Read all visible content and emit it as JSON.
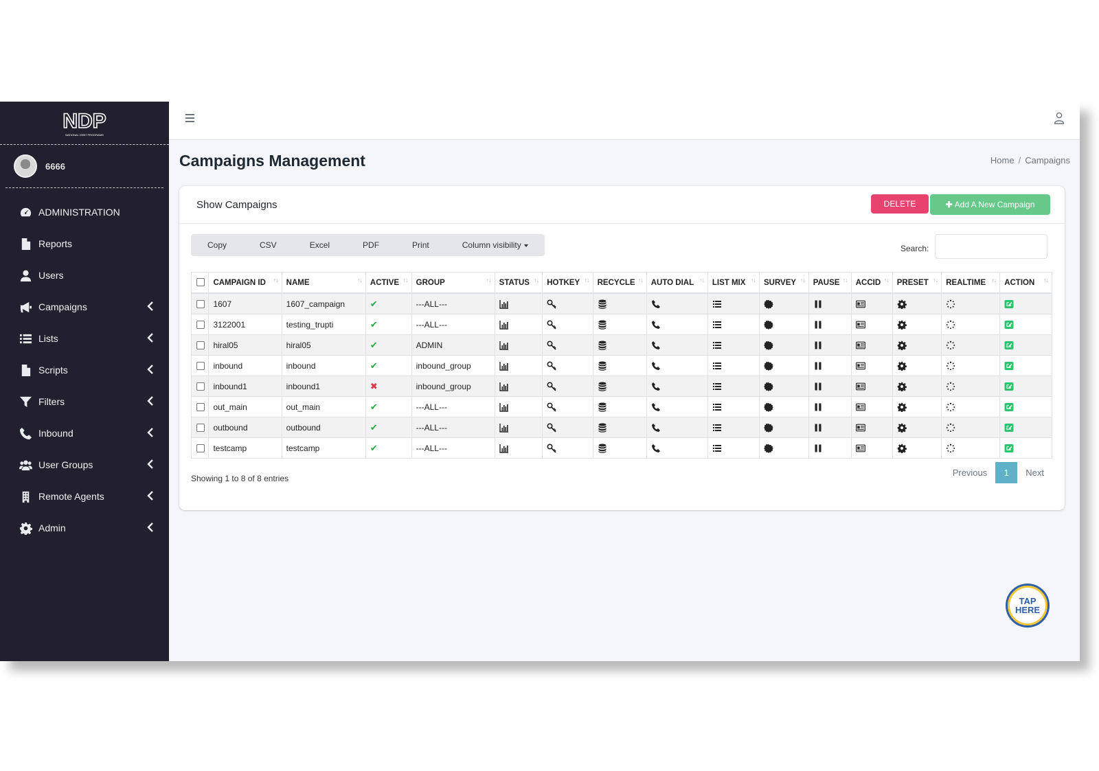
{
  "brand": {
    "logo_text": "NDP",
    "logo_subtext": "NATIONAL DEBT PROGRAMS"
  },
  "user": {
    "name": "6666"
  },
  "sidebar": {
    "items": [
      {
        "label": "ADMINISTRATION",
        "icon": "dashboard-icon",
        "has_chevron": false
      },
      {
        "label": "Reports",
        "icon": "file-icon",
        "has_chevron": false
      },
      {
        "label": "Users",
        "icon": "user-icon",
        "has_chevron": false
      },
      {
        "label": "Campaigns",
        "icon": "megaphone-icon",
        "has_chevron": true
      },
      {
        "label": "Lists",
        "icon": "list-icon",
        "has_chevron": true
      },
      {
        "label": "Scripts",
        "icon": "file-icon",
        "has_chevron": true
      },
      {
        "label": "Filters",
        "icon": "filter-icon",
        "has_chevron": true
      },
      {
        "label": "Inbound",
        "icon": "phone-icon",
        "has_chevron": true
      },
      {
        "label": "User Groups",
        "icon": "users-icon",
        "has_chevron": true
      },
      {
        "label": "Remote Agents",
        "icon": "building-icon",
        "has_chevron": true
      },
      {
        "label": "Admin",
        "icon": "gear-icon",
        "has_chevron": true
      }
    ]
  },
  "header": {
    "title": "Campaigns Management",
    "breadcrumb": {
      "home": "Home",
      "separator": "/",
      "current": "Campaigns"
    }
  },
  "card": {
    "title": "Show Campaigns",
    "delete_label": "DELETE",
    "add_label": "Add A New Campaign"
  },
  "toolbar": {
    "buttons": [
      "Copy",
      "CSV",
      "Excel",
      "PDF",
      "Print",
      "Column visibility"
    ],
    "search_label": "Search:",
    "search_value": ""
  },
  "table": {
    "columns": [
      "CAMPAIGN ID",
      "NAME",
      "ACTIVE",
      "GROUP",
      "STATUS",
      "HOTKEY",
      "RECYCLE",
      "AUTO DIAL",
      "LIST MIX",
      "SURVEY",
      "PAUSE",
      "ACCID",
      "PRESET",
      "REALTIME",
      "ACTION"
    ],
    "rows": [
      {
        "id": "1607",
        "name": "1607_campaign",
        "active": true,
        "group": "---ALL---"
      },
      {
        "id": "3122001",
        "name": "testing_trupti",
        "active": true,
        "group": "---ALL---"
      },
      {
        "id": "hiral05",
        "name": "hiral05",
        "active": true,
        "group": "ADMIN"
      },
      {
        "id": "inbound",
        "name": "inbound",
        "active": true,
        "group": "inbound_group"
      },
      {
        "id": "inbound1",
        "name": "inbound1",
        "active": false,
        "group": "inbound_group"
      },
      {
        "id": "out_main",
        "name": "out_main",
        "active": true,
        "group": "---ALL---"
      },
      {
        "id": "outbound",
        "name": "outbound",
        "active": true,
        "group": "---ALL---"
      },
      {
        "id": "testcamp",
        "name": "testcamp",
        "active": true,
        "group": "---ALL---"
      }
    ]
  },
  "footer": {
    "info": "Showing 1 to 8 of 8 entries",
    "previous": "Previous",
    "page": "1",
    "next": "Next"
  },
  "tap": {
    "line1": "TAP",
    "line2": "HERE"
  },
  "colors": {
    "sidebar_bg": "#22202f",
    "delete": "#e8436f",
    "add": "#66c98a",
    "page_active": "#5eb1c6",
    "check": "#28a745",
    "cross": "#dc3545"
  }
}
